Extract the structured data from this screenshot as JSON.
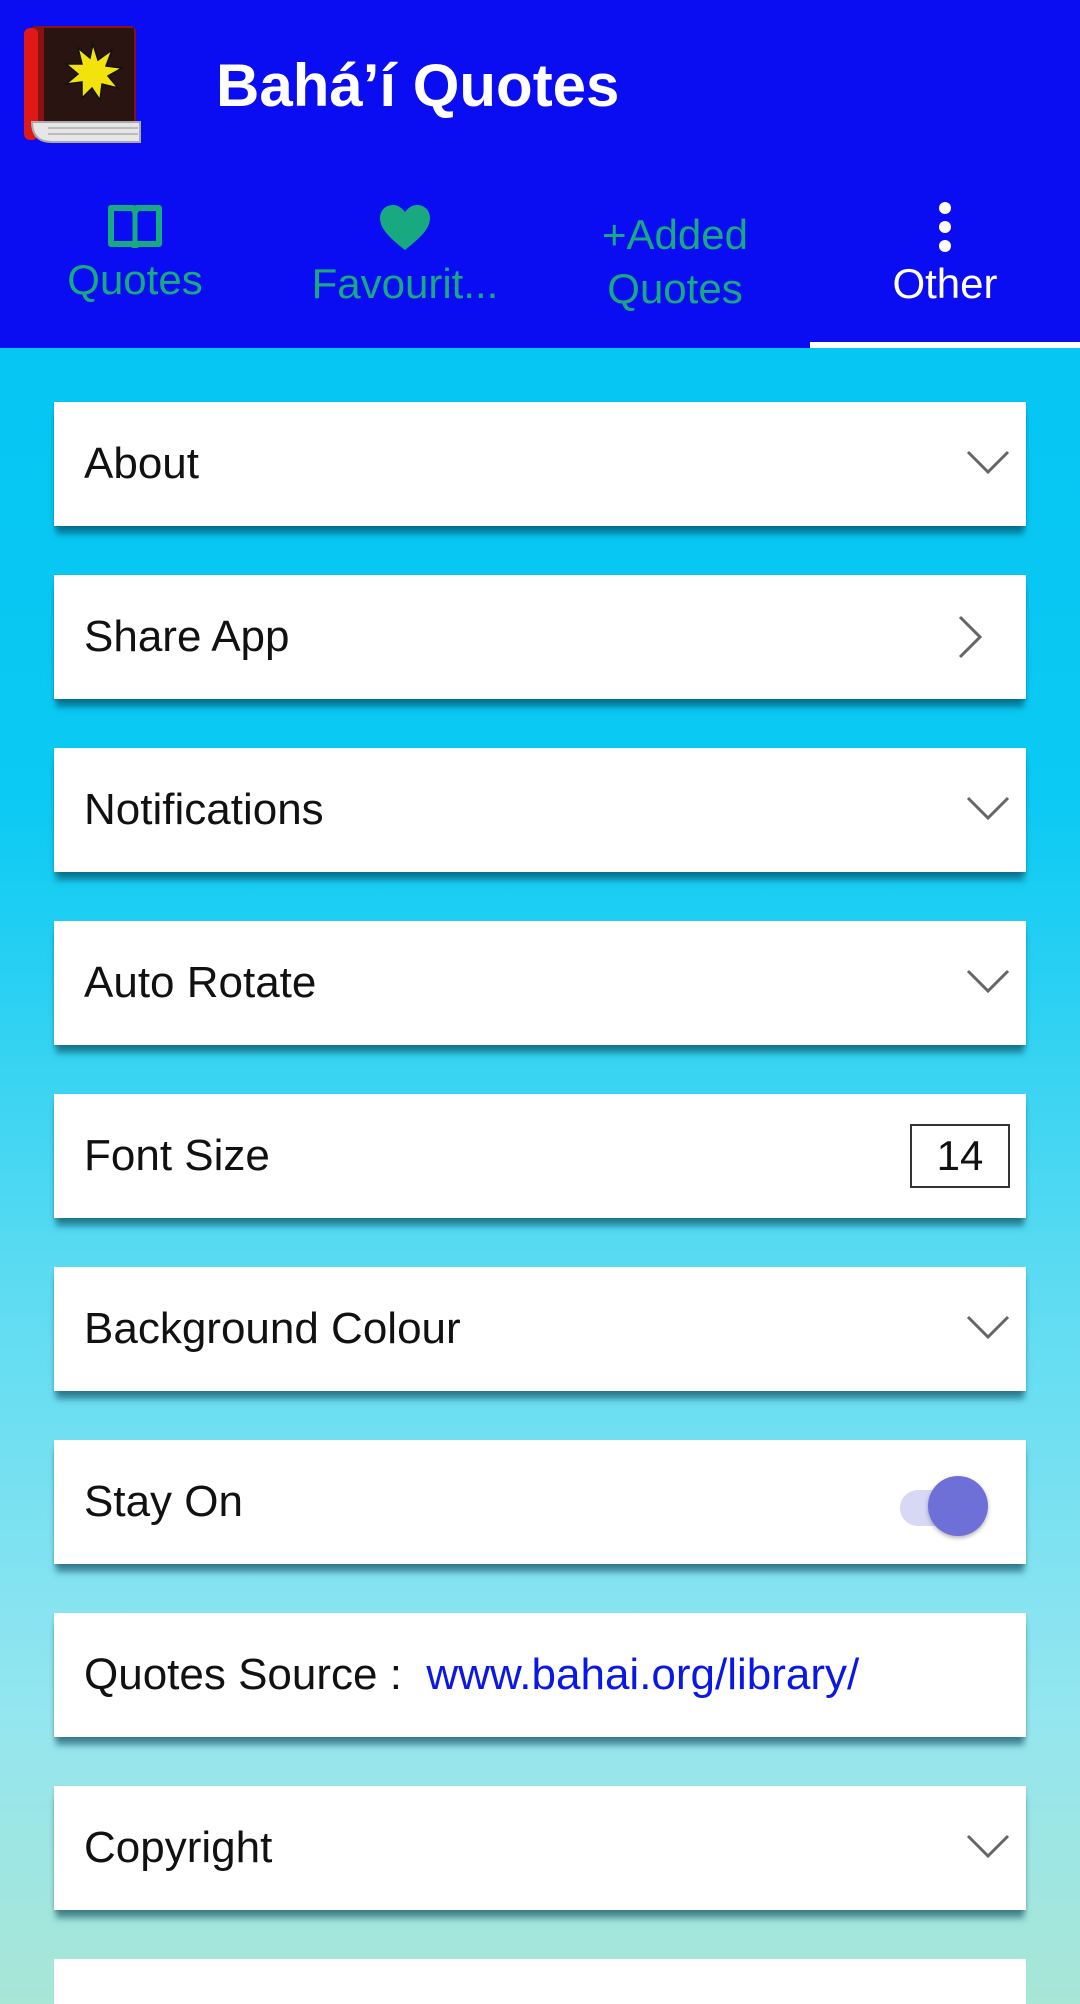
{
  "app": {
    "title": "Bahá’í Quotes",
    "header_color": "#0a0cf2"
  },
  "tabs": [
    {
      "icon": "book-open-icon",
      "label": "Quotes"
    },
    {
      "icon": "heart-icon",
      "label": "Favourit..."
    },
    {
      "icon": "plus-icon",
      "label_line1": "+Added",
      "label_line2": "Quotes"
    },
    {
      "icon": "more-vertical-icon",
      "label": "Other",
      "active": true
    }
  ],
  "settings": {
    "about": "About",
    "share_app": "Share App",
    "notifications": "Notifications",
    "auto_rotate": "Auto Rotate",
    "font_size": {
      "label": "Font Size",
      "value": "14"
    },
    "background_colour": "Background Colour",
    "stay_on": {
      "label": "Stay On",
      "enabled": true
    },
    "quotes_source": {
      "label": "Quotes Source :",
      "link": "www.bahai.org/library/"
    },
    "copyright": "Copyright"
  },
  "colors": {
    "tab_inactive": "#18a981",
    "tab_active": "#ffffff",
    "link": "#0a17e6",
    "toggle_on": "#6f6fd8"
  }
}
